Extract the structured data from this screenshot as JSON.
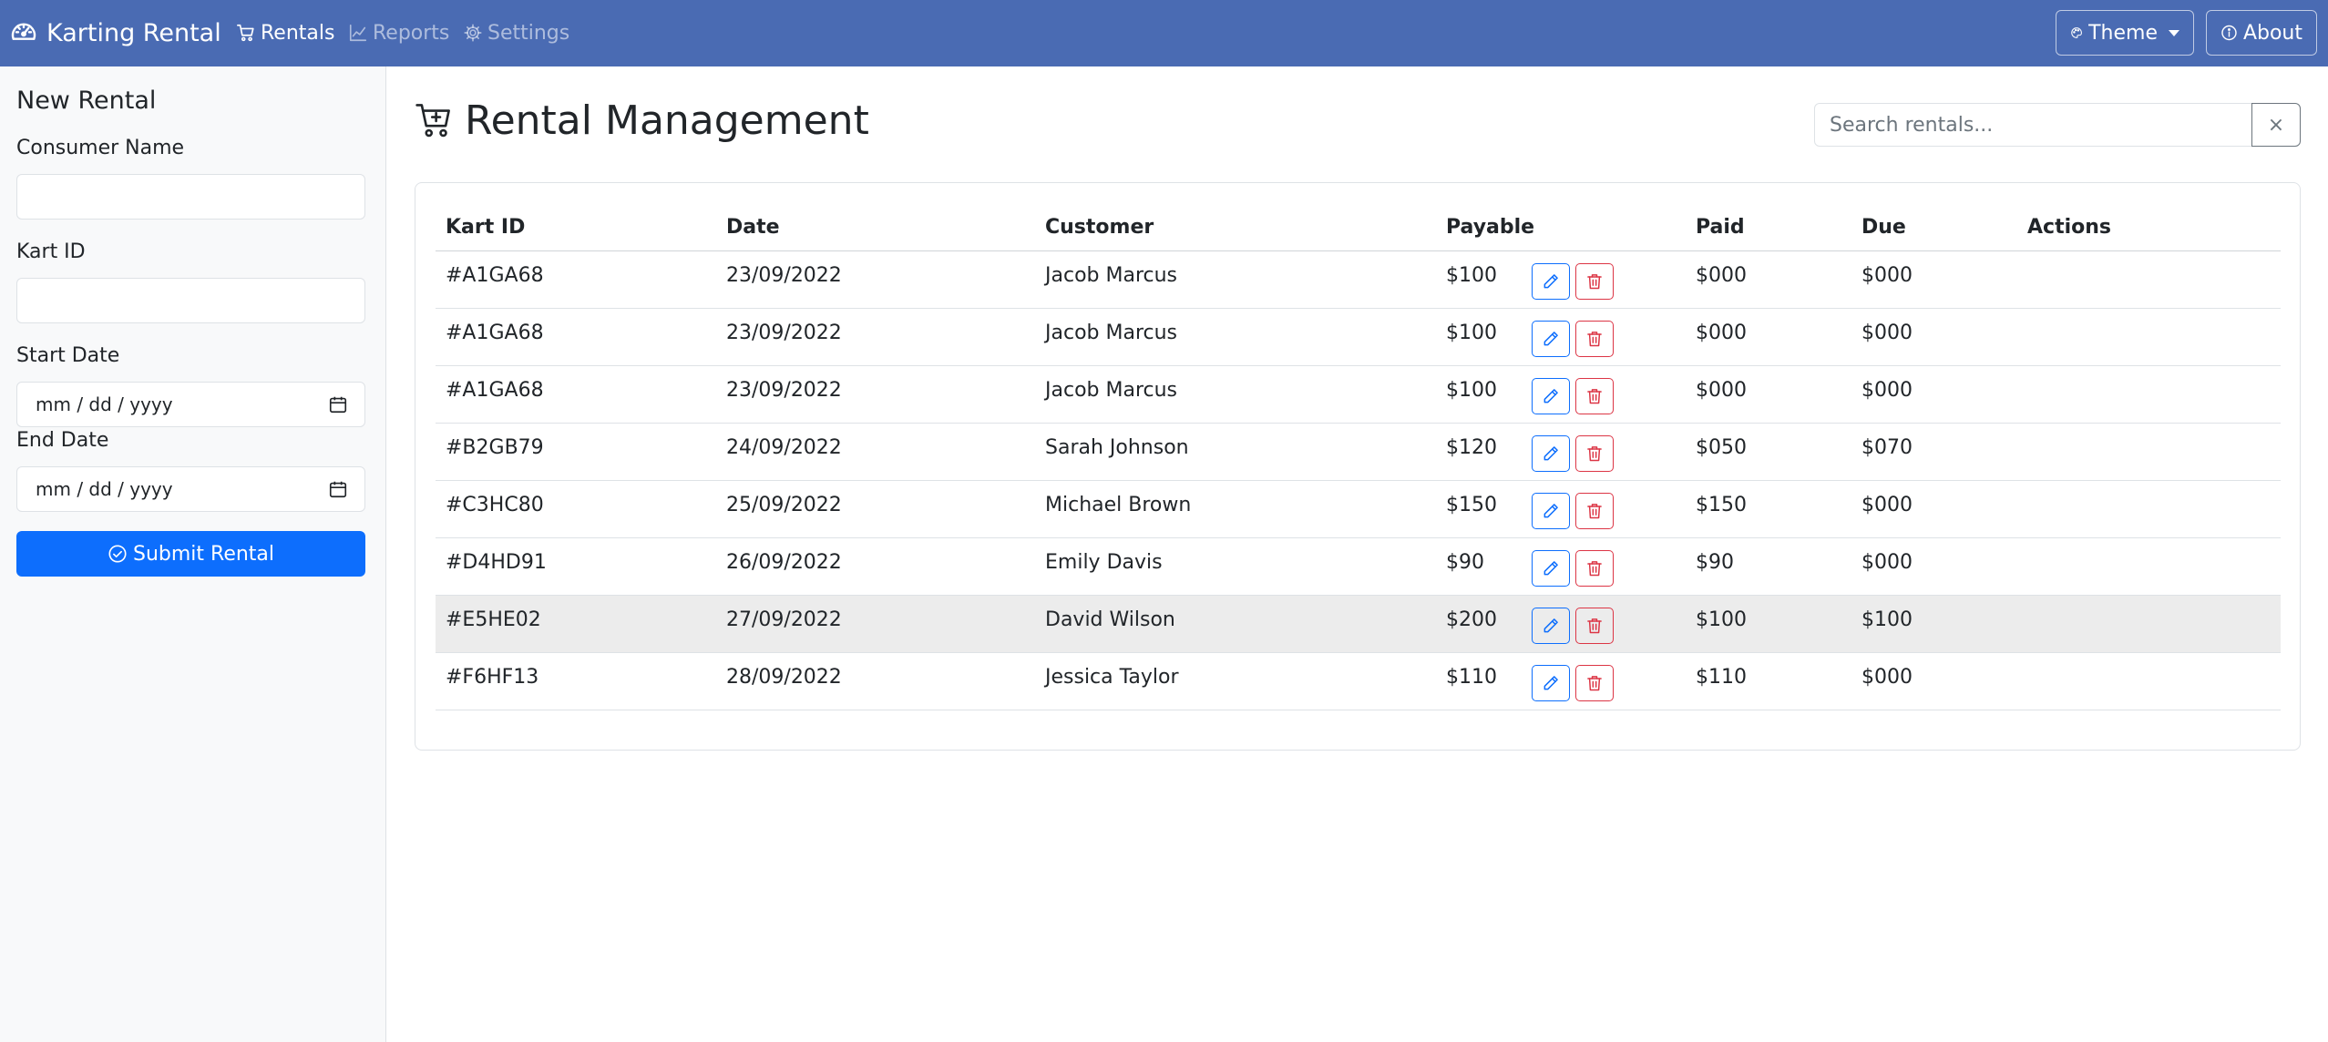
{
  "navbar": {
    "brand": "Karting Rental",
    "links": [
      {
        "label": "Rentals",
        "icon": "cart-icon",
        "active": true
      },
      {
        "label": "Reports",
        "icon": "graph-up-icon",
        "active": false
      },
      {
        "label": "Settings",
        "icon": "gear-icon",
        "active": false
      }
    ],
    "theme_label": "Theme",
    "about_label": "About",
    "bg_color": "#4a6bb3"
  },
  "sidebar": {
    "title": "New Rental",
    "consumer_label": "Consumer Name",
    "consumer_value": "",
    "kart_label": "Kart ID",
    "kart_value": "",
    "start_label": "Start Date",
    "start_placeholder": "mm / dd / yyyy",
    "end_label": "End Date",
    "end_placeholder": "mm / dd / yyyy",
    "submit_label": "Submit Rental",
    "submit_color": "#0d6efd"
  },
  "main": {
    "title": "Rental Management",
    "search_placeholder": "Search rentals...",
    "search_clear": "×",
    "columns": [
      "Kart ID",
      "Date",
      "Customer",
      "Payable",
      "Paid",
      "Due",
      "Actions"
    ],
    "rows": [
      {
        "kart": "#A1GA68",
        "date": "23/09/2022",
        "customer": "Jacob Marcus",
        "payable": "$100",
        "paid": "$000",
        "due": "$000"
      },
      {
        "kart": "#A1GA68",
        "date": "23/09/2022",
        "customer": "Jacob Marcus",
        "payable": "$100",
        "paid": "$000",
        "due": "$000"
      },
      {
        "kart": "#A1GA68",
        "date": "23/09/2022",
        "customer": "Jacob Marcus",
        "payable": "$100",
        "paid": "$000",
        "due": "$000"
      },
      {
        "kart": "#B2GB79",
        "date": "24/09/2022",
        "customer": "Sarah Johnson",
        "payable": "$120",
        "paid": "$050",
        "due": "$070"
      },
      {
        "kart": "#C3HC80",
        "date": "25/09/2022",
        "customer": "Michael Brown",
        "payable": "$150",
        "paid": "$150",
        "due": "$000"
      },
      {
        "kart": "#D4HD91",
        "date": "26/09/2022",
        "customer": "Emily Davis",
        "payable": "$90",
        "paid": "$90",
        "due": "$000"
      },
      {
        "kart": "#E5HE02",
        "date": "27/09/2022",
        "customer": "David Wilson",
        "payable": "$200",
        "paid": "$100",
        "due": "$100",
        "hovered": true
      },
      {
        "kart": "#F6HF13",
        "date": "28/09/2022",
        "customer": "Jessica Taylor",
        "payable": "$110",
        "paid": "$110",
        "due": "$000"
      }
    ],
    "edit_icon": "pencil-icon",
    "delete_icon": "trash-icon",
    "edit_color": "#0d6efd",
    "delete_color": "#dc3545"
  }
}
